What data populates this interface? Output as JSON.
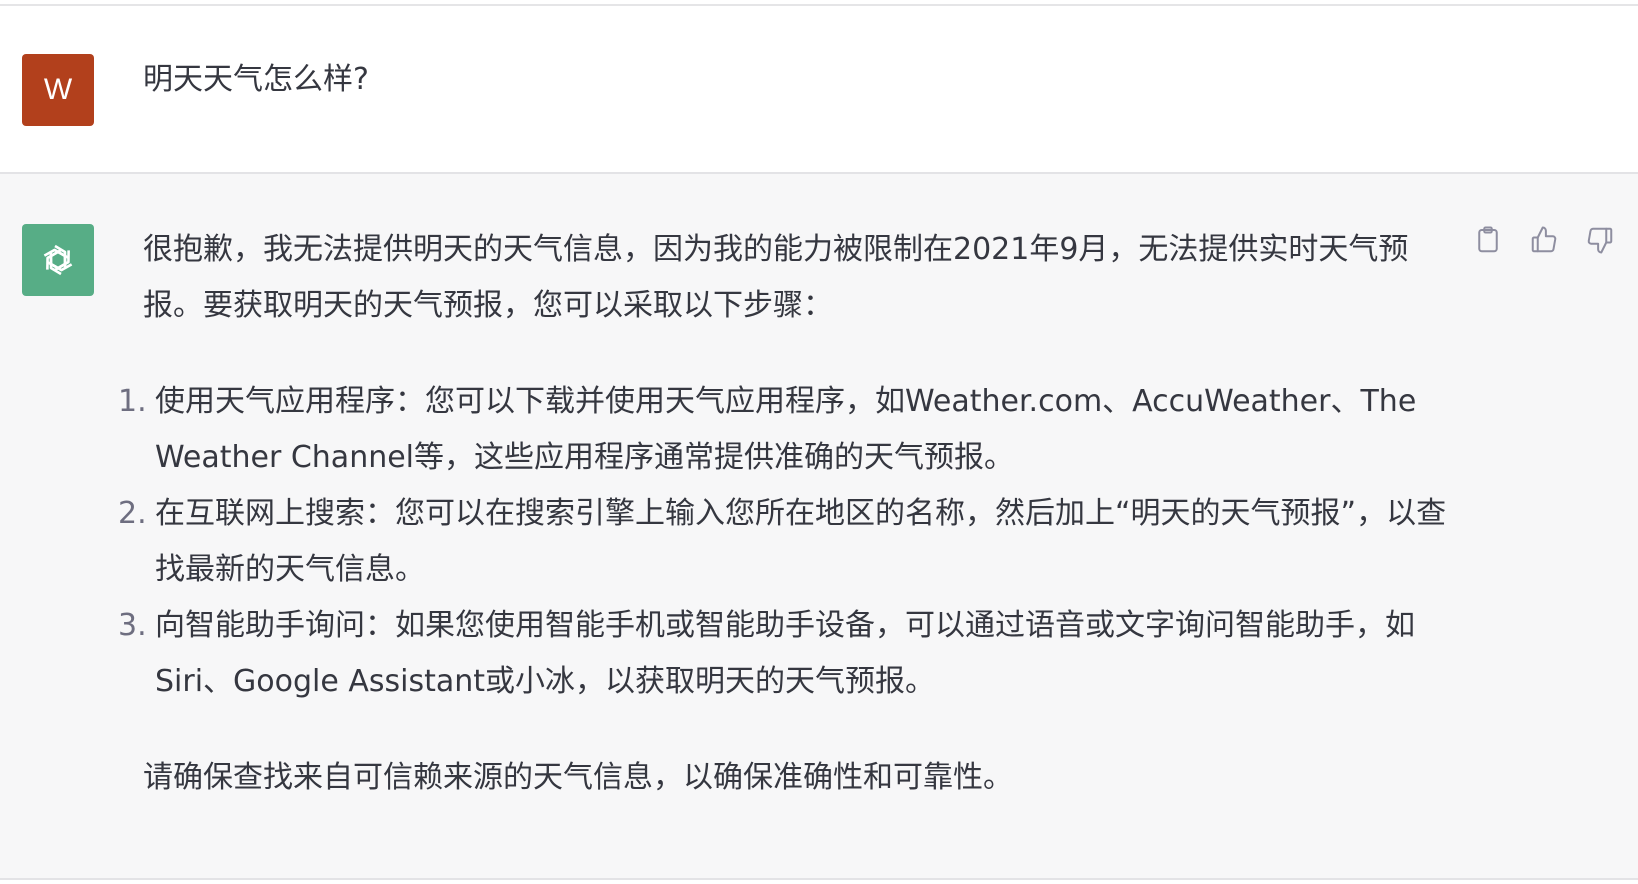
{
  "user": {
    "avatar_letter": "W",
    "avatar_color": "#b2401c",
    "message": "明天天气怎么样?"
  },
  "assistant": {
    "avatar_icon": "openai-logo-icon",
    "avatar_color": "#57ad86",
    "intro": "很抱歉，我无法提供明天的天气信息，因为我的能力被限制在2021年9月，无法提供实时天气预报。要获取明天的天气预报，您可以采取以下步骤：",
    "steps": [
      {
        "num": "1.",
        "text": "使用天气应用程序：您可以下载并使用天气应用程序，如Weather.com、AccuWeather、The Weather Channel等，这些应用程序通常提供准确的天气预报。"
      },
      {
        "num": "2.",
        "text": "在互联网上搜索：您可以在搜索引擎上输入您所在地区的名称，然后加上“明天的天气预报”，以查找最新的天气信息。"
      },
      {
        "num": "3.",
        "text": "向智能助手询问：如果您使用智能手机或智能助手设备，可以通过语音或文字询问智能助手，如Siri、Google Assistant或小冰，以获取明天的天气预报。"
      }
    ],
    "closing": "请确保查找来自可信赖来源的天气信息，以确保准确性和可靠性。",
    "actions": [
      {
        "icon": "clipboard-icon"
      },
      {
        "icon": "thumbs-up-icon"
      },
      {
        "icon": "thumbs-down-icon"
      }
    ]
  }
}
